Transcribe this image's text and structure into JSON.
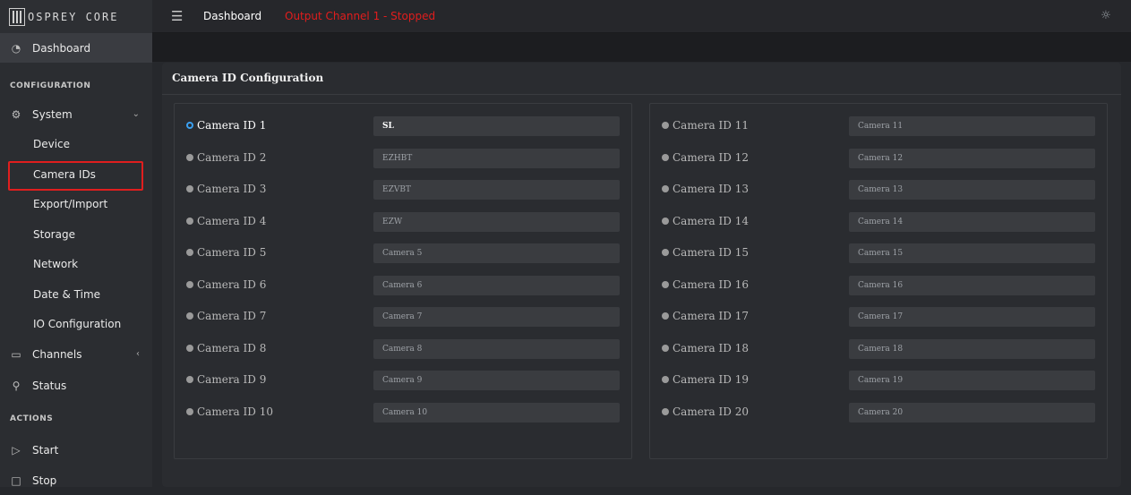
{
  "topbar": {
    "brand": "OSPREY CORE",
    "title": "Dashboard",
    "status": "Output Channel 1 - Stopped"
  },
  "sidebar": {
    "dashboard": "Dashboard",
    "configuration_header": "CONFIGURATION",
    "system": "System",
    "sub_items": [
      "Device",
      "Camera IDs",
      "Export/Import",
      "Storage",
      "Network",
      "Date & Time",
      "IO Configuration"
    ],
    "channels": "Channels",
    "status": "Status",
    "actions_header": "ACTIONS",
    "start": "Start",
    "stop": "Stop",
    "highlighted_item": "Camera IDs"
  },
  "card": {
    "title": "Camera ID Configuration"
  },
  "cameras_left": [
    {
      "label": "Camera ID 1",
      "value": "SL",
      "selected": true
    },
    {
      "label": "Camera ID 2",
      "value": "EZHBT"
    },
    {
      "label": "Camera ID 3",
      "value": "EZVBT"
    },
    {
      "label": "Camera ID 4",
      "value": "EZW"
    },
    {
      "label": "Camera ID 5",
      "value": "Camera 5"
    },
    {
      "label": "Camera ID 6",
      "value": "Camera 6"
    },
    {
      "label": "Camera ID 7",
      "value": "Camera 7"
    },
    {
      "label": "Camera ID 8",
      "value": "Camera 8"
    },
    {
      "label": "Camera ID 9",
      "value": "Camera 9"
    },
    {
      "label": "Camera ID 10",
      "value": "Camera 10"
    }
  ],
  "cameras_right": [
    {
      "label": "Camera ID 11",
      "value": "Camera 11"
    },
    {
      "label": "Camera ID 12",
      "value": "Camera 12"
    },
    {
      "label": "Camera ID 13",
      "value": "Camera 13"
    },
    {
      "label": "Camera ID 14",
      "value": "Camera 14"
    },
    {
      "label": "Camera ID 15",
      "value": "Camera 15"
    },
    {
      "label": "Camera ID 16",
      "value": "Camera 16"
    },
    {
      "label": "Camera ID 17",
      "value": "Camera 17"
    },
    {
      "label": "Camera ID 18",
      "value": "Camera 18"
    },
    {
      "label": "Camera ID 19",
      "value": "Camera 19"
    },
    {
      "label": "Camera ID 20",
      "value": "Camera 20"
    }
  ],
  "colors": {
    "accent": "#3ba0f0",
    "status_red": "#e11d1d",
    "highlight_red": "#e01e1e"
  }
}
